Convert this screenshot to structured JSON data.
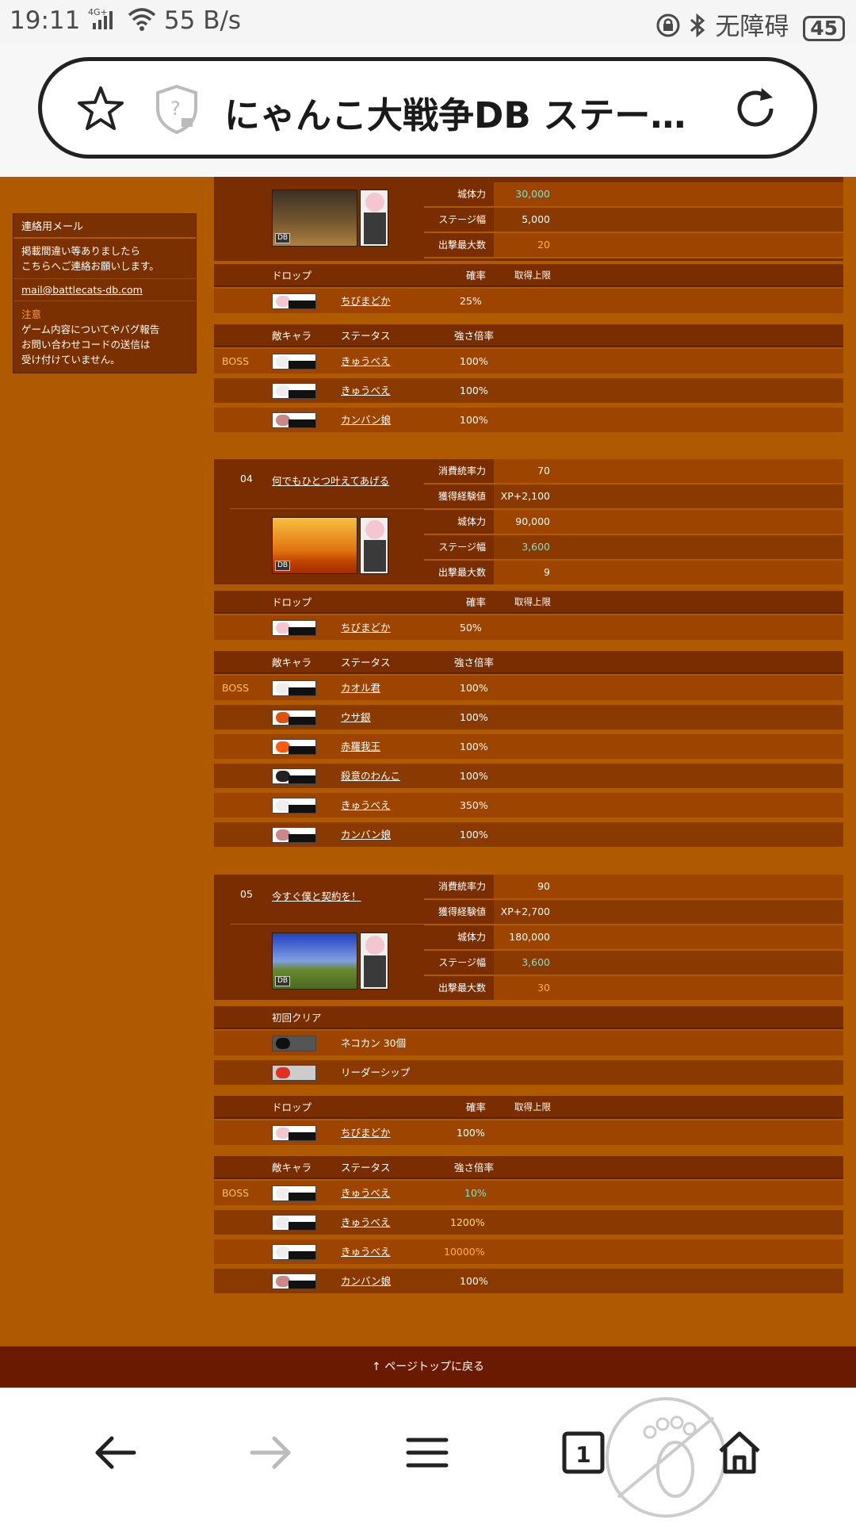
{
  "status": {
    "time": "19:11",
    "network": "4G+",
    "speed": "55 B/s",
    "ime": "无障碍",
    "battery": "45"
  },
  "browser": {
    "title": "にゃんこ大戦争DB ステー…",
    "tabs_count": "1",
    "icons": [
      "star-icon",
      "shield-icon",
      "reload-icon",
      "back-icon",
      "forward-icon",
      "menu-icon",
      "tabs-icon",
      "home-icon"
    ]
  },
  "sidebar": {
    "header": "連絡用メール",
    "body1": "掲載間違い等ありましたら",
    "body2": "こちらへご連絡お願いします。",
    "email": "mail@battlecats-db.com",
    "notice_title": "注意",
    "notice1": "ゲーム内容についてやバグ報告",
    "notice2": "お問い合わせコードの送信は",
    "notice3": "受け付けていません。"
  },
  "labels": {
    "castle_hp": "城体力",
    "stage_width": "ステージ幅",
    "max_enemies": "出撃最大数",
    "cost": "消費統率力",
    "xp": "獲得経験値",
    "drop": "ドロップ",
    "rate": "確率",
    "limit": "取得上限",
    "enemy": "敵キャラ",
    "status": "ステータス",
    "mag": "強さ倍率",
    "boss": "BOSS",
    "first_clear": "初回クリア"
  },
  "stage3": {
    "castle_hp": "30,000",
    "stage_width": "5,000",
    "max_enemies": "20",
    "drop_name": "ちびまどか",
    "drop_rate": "25%",
    "enemies": [
      {
        "name": "きゅうべえ",
        "mag": "100%"
      },
      {
        "name": "きゅうべえ",
        "mag": "100%"
      },
      {
        "name": "カンバン娘",
        "mag": "100%"
      }
    ]
  },
  "stage4": {
    "no": "04",
    "name": "何でもひとつ叶えてあげる",
    "cost": "70",
    "xp": "XP+2,100",
    "castle_hp": "90,000",
    "stage_width": "3,600",
    "max_enemies": "9",
    "drop_name": "ちびまどか",
    "drop_rate": "50%",
    "enemies": [
      {
        "name": "カオル君",
        "mag": "100%"
      },
      {
        "name": "ウサ銀",
        "mag": "100%"
      },
      {
        "name": "赤羅我王",
        "mag": "100%"
      },
      {
        "name": "殺意のわんこ",
        "mag": "100%"
      },
      {
        "name": "きゅうべえ",
        "mag": "350%"
      },
      {
        "name": "カンバン娘",
        "mag": "100%"
      }
    ]
  },
  "stage5": {
    "no": "05",
    "name": "今すぐ僕と契約を！",
    "cost": "90",
    "xp": "XP+2,700",
    "castle_hp": "180,000",
    "stage_width": "3,600",
    "max_enemies": "30",
    "first1": "ネコカン 30個",
    "first2": "リーダーシップ",
    "drop_name": "ちびまどか",
    "drop_rate": "100%",
    "enemies": [
      {
        "name": "きゅうべえ",
        "mag": "10%"
      },
      {
        "name": "きゅうべえ",
        "mag": "1200%"
      },
      {
        "name": "きゅうべえ",
        "mag": "10000%"
      },
      {
        "name": "カンバン娘",
        "mag": "100%"
      }
    ]
  },
  "footer": {
    "pagetop": "↑ ページトップに戻る"
  },
  "colors": {
    "page_bg": "#b05a00",
    "row": "#9d4500",
    "row_alt": "#8a3a00",
    "header": "#7a2e00",
    "highlight_cyan": "#7fe0d0",
    "highlight_orange": "#ffb040",
    "highlight_yellow": "#ffe070"
  }
}
